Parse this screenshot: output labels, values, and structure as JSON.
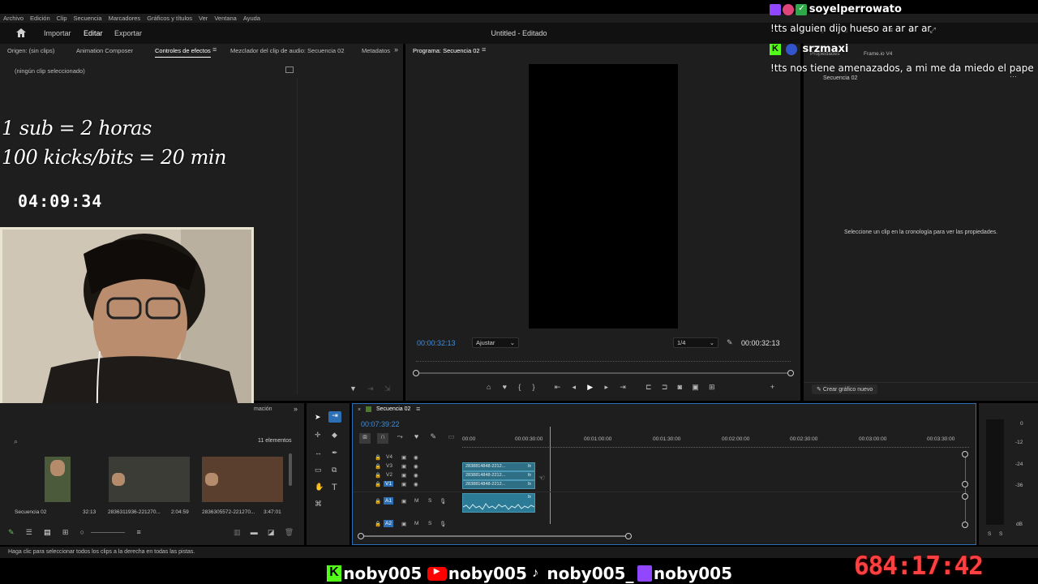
{
  "menu": [
    "Archivo",
    "Edición",
    "Clip",
    "Secuencia",
    "Marcadores",
    "Gráficos y títulos",
    "Ver",
    "Ventana",
    "Ayuda"
  ],
  "header": {
    "home_icon": "home-icon",
    "tabs": [
      "Importar",
      "Editar",
      "Exportar"
    ],
    "active_tab": "Editar",
    "title": "Untitled - Editado"
  },
  "source_panel": {
    "tabs": [
      "Origen: (sin clips)",
      "Animation Composer",
      "Controles de efectos",
      "Mezclador del clip de audio: Secuencia 02",
      "Metadatos"
    ],
    "active_tab": "Controles de efectos",
    "no_clip": "(ningún clip seleccionado)"
  },
  "program_panel": {
    "title": "Programa: Secuencia 02",
    "timecode_left": "00:00:32:13",
    "fit_select": "Ajustar",
    "quality_select": "1/4",
    "timecode_right": "00:00:32:13"
  },
  "properties_panel": {
    "tabs": [
      "Propiedades",
      "Frame.io V4"
    ],
    "sequence": "Secuencia 02",
    "message": "Seleccione un clip en la cronología para ver las propiedades.",
    "new_graphic": "Crear gráfico nuevo"
  },
  "project_panel": {
    "count": "11 elementos",
    "tab_suffix": "mación",
    "items": [
      {
        "name": "Secuencia 02",
        "duration": "32:13"
      },
      {
        "name": "2836311936-221270...",
        "duration": "2:04:59"
      },
      {
        "name": "2836305572-221270...",
        "duration": "3:47:01"
      }
    ]
  },
  "timeline": {
    "sequence_tab": "Secuencia 02",
    "timecode": "00:07:39:22",
    "ruler": [
      "00:00",
      "00:00:30:00",
      "00:01:00:00",
      "00:01:30:00",
      "00:02:00:00",
      "00:02:30:00",
      "00:03:00:00",
      "00:03:30:00"
    ],
    "video_tracks": [
      "V4",
      "V3",
      "V2",
      "V1"
    ],
    "audio_tracks": [
      "A1",
      "A2"
    ],
    "clip_label": "2838814848-2212...",
    "fx": "fx",
    "track_buttons": {
      "mute": "M",
      "solo": "S"
    }
  },
  "audio_meter": {
    "scale": [
      "0",
      "-12",
      "-24",
      "-36",
      "dB"
    ],
    "solo": [
      "S",
      "S"
    ]
  },
  "status_bar": "Haga clic para seleccionar todos los clips a la derecha en todas las pistas.",
  "overlay": {
    "line1": "1 sub = 2 horas",
    "line2": "100 kicks/bits = 20 min",
    "countdown": "04:09:34",
    "uptime": "684:17:42"
  },
  "chat": [
    {
      "user": "soyelperrowato",
      "message": "!tts alguien dijo hueso ar ar ar ar"
    },
    {
      "user": "srzmaxi",
      "message": "!tts nos tiene amenazados, a mi me da miedo el pape"
    }
  ],
  "socials": [
    "noby005",
    "noby005",
    "noby005_",
    "noby005"
  ],
  "colors": {
    "accent_blue": "#3f8fe0",
    "clip_teal": "#2f6f86",
    "kick_green": "#53fc18",
    "youtube_red": "#ff0000",
    "twitch_purple": "#9146ff",
    "uptime_red": "#ff4040"
  }
}
